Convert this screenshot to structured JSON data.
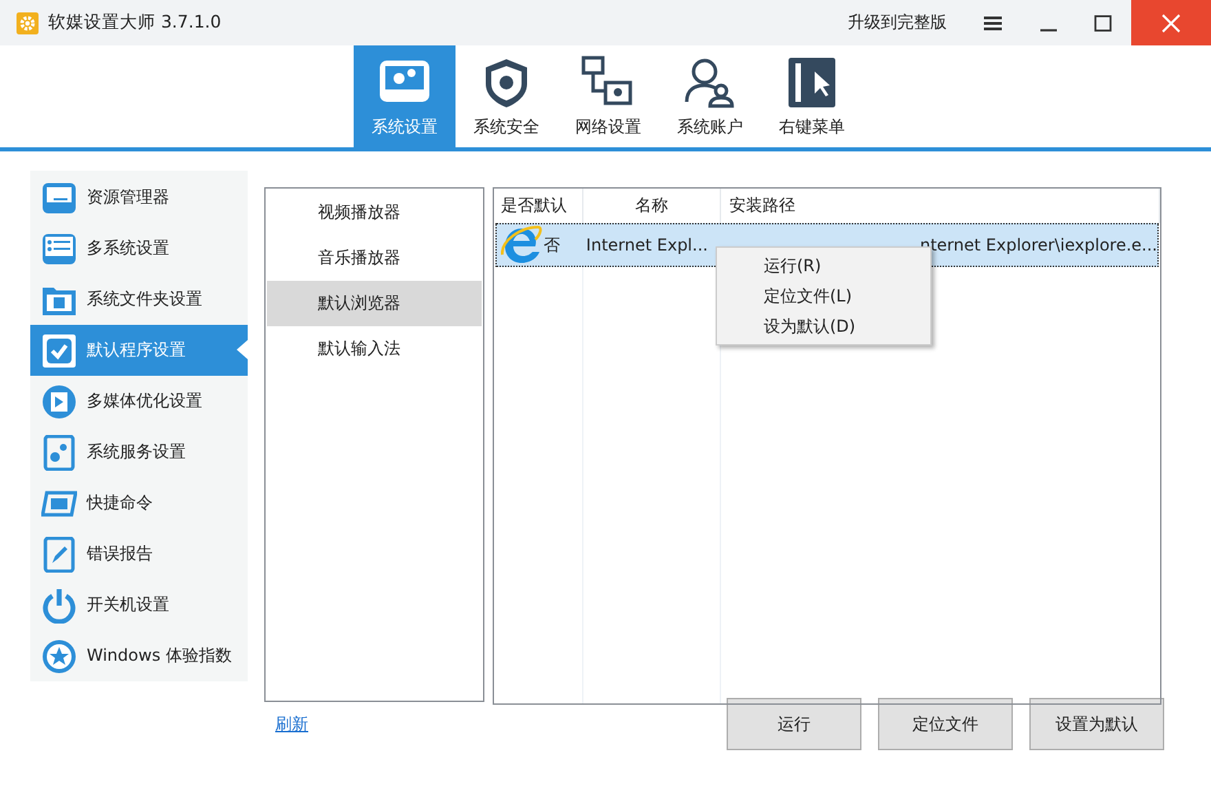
{
  "window": {
    "title": "软媒设置大师 3.7.1.0",
    "upgrade_link": "升级到完整版"
  },
  "tabs": [
    {
      "label": "系统设置",
      "selected": true
    },
    {
      "label": "系统安全",
      "selected": false
    },
    {
      "label": "网络设置",
      "selected": false
    },
    {
      "label": "系统账户",
      "selected": false
    },
    {
      "label": "右键菜单",
      "selected": false
    }
  ],
  "sidebar": {
    "items": [
      {
        "label": "资源管理器",
        "selected": false
      },
      {
        "label": "多系统设置",
        "selected": false
      },
      {
        "label": "系统文件夹设置",
        "selected": false
      },
      {
        "label": "默认程序设置",
        "selected": true
      },
      {
        "label": "多媒体优化设置",
        "selected": false
      },
      {
        "label": "系统服务设置",
        "selected": false
      },
      {
        "label": "快捷命令",
        "selected": false
      },
      {
        "label": "错误报告",
        "selected": false
      },
      {
        "label": "开关机设置",
        "selected": false
      },
      {
        "label": "Windows 体验指数",
        "selected": false
      }
    ]
  },
  "categories": [
    {
      "label": "视频播放器",
      "selected": false
    },
    {
      "label": "音乐播放器",
      "selected": false
    },
    {
      "label": "默认浏览器",
      "selected": true
    },
    {
      "label": "默认输入法",
      "selected": false
    }
  ],
  "table": {
    "columns": [
      "是否默认",
      "名称",
      "安装路径"
    ],
    "rows": [
      {
        "is_default": "否",
        "name": "Internet Expl...",
        "path": "nternet Explorer\\iexplore.e...",
        "selected": true
      }
    ]
  },
  "context_menu": {
    "items": [
      "运行(R)",
      "定位文件(L)",
      "设为默认(D)"
    ]
  },
  "refresh_link": "刷新",
  "buttons": [
    "运行",
    "定位文件",
    "设置为默认"
  ]
}
